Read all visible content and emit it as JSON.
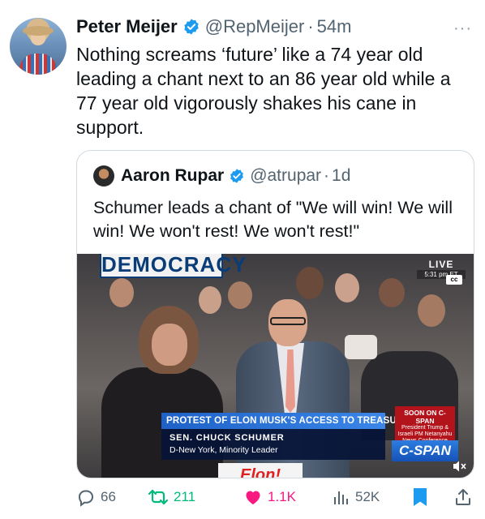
{
  "tweet": {
    "author_name": "Peter Meijer",
    "handle": "@RepMeijer",
    "separator": "·",
    "time": "54m",
    "more_label": "···",
    "text": "Nothing screams ‘future’ like a 74 year old leading a chant next to an 86 year old while a 77 year old vigorously shakes his cane in support."
  },
  "quoted": {
    "author_name": "Aaron Rupar",
    "handle": "@atrupar",
    "separator": "·",
    "time": "1d",
    "text": "Schumer leads a chant of \"We will win! We will win! We won't rest! We won't rest!\"",
    "video": {
      "top_sign": "DEMOCRACY",
      "bottom_sign": "Elon!",
      "live_label": "LIVE",
      "live_time": "5:31 pm ET",
      "cc": "cc",
      "lower_third_title": "PROTEST OF ELON MUSK'S ACCESS TO TREASURY DEPT.",
      "lower_third_name": "SEN. CHUCK SCHUMER",
      "lower_third_role": "D-New York, Minority Leader",
      "soon_title": "SOON ON C-SPAN",
      "soon_body": "President Trump & Israeli PM Netanyahu News Conference",
      "network": "C-SPAN"
    }
  },
  "actions": {
    "replies": "66",
    "retweets": "211",
    "likes": "1.1K",
    "views": "52K"
  },
  "colors": {
    "verified": "#1d9bf0",
    "retweet": "#00ba7c",
    "like": "#f91880",
    "bookmark": "#1d9bf0",
    "secondary_text": "#536471"
  }
}
